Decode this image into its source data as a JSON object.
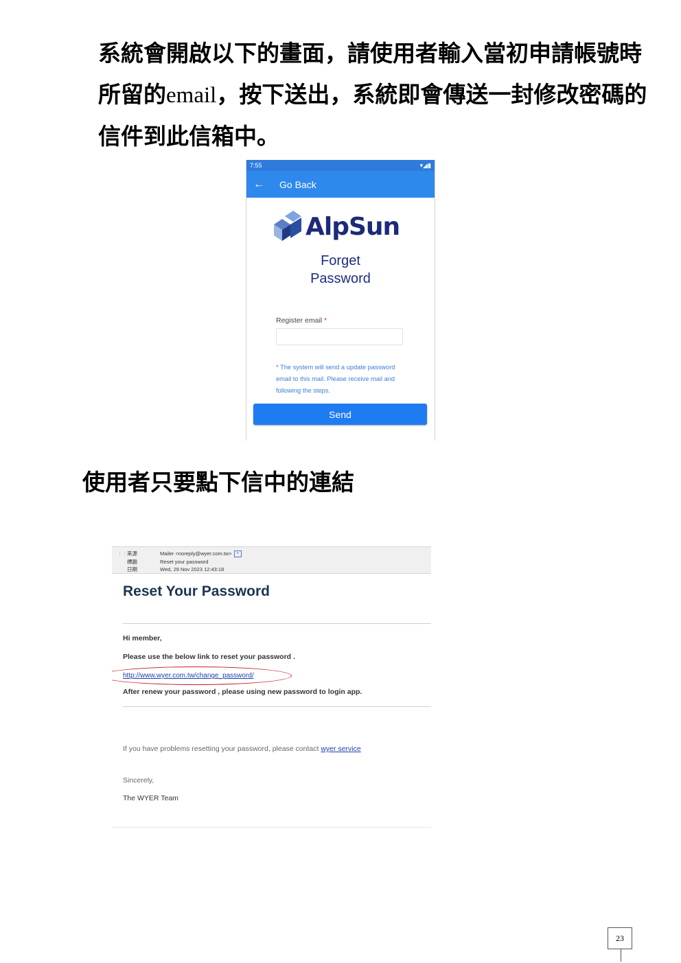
{
  "paragraph": {
    "part1": "系統會開啟以下的畫面，請使用者輸入當初申請帳號時所留的",
    "email_word": "email",
    "part2": "，按下送出，系統即會傳送一封修改密碼的信件到此信箱中。"
  },
  "phone": {
    "status_time": "7:55",
    "status_icons": "▾◢▮",
    "back_title": "Go Back",
    "logo_text": "AlpSun",
    "title_line1": "Forget",
    "title_line2": "Password",
    "register_label": "Register email",
    "required_mark": "*",
    "email_value": "",
    "note": "* The system will send a update password email to this mail. Please receive mail and following the steps.",
    "send_label": "Send",
    "colors": {
      "appbar": "#2f88ec",
      "button": "#1f7bf2",
      "title": "#1f2d7d"
    }
  },
  "heading2": "使用者只要點下信中的連結",
  "email": {
    "from_key": "來源",
    "from_value": "Mailer <noreply@wyer.com.tw>",
    "subject_key": "標題",
    "subject_value": "Reset your password",
    "date_key": "日期",
    "date_value": "Wed, 29 Nov 2023 12:43:18",
    "title": "Reset Your Password",
    "greeting": "Hi member,",
    "instruction": "Please use the below link to reset your password .",
    "link": "http://www.wyer.com.tw/change_password/",
    "after_text": "After renew your password , please using new password to login app.",
    "problem_text": "If you have problems resetting your password, please contact",
    "service_link": "wyer service",
    "sincerely": "Sincerely,",
    "team": "The WYER Team"
  },
  "page_number": "23"
}
